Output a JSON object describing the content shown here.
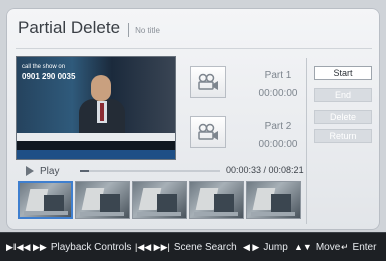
{
  "header": {
    "title": "Partial Delete",
    "subtitle": "No title"
  },
  "preview": {
    "phone_small": "call the show on",
    "phone_number": "0901 290 0035"
  },
  "parts": [
    {
      "label": "Part 1",
      "time": "00:00:00"
    },
    {
      "label": "Part 2",
      "time": "00:00:00"
    }
  ],
  "buttons": {
    "start": "Start",
    "end": "End",
    "delete": "Delete",
    "return": "Return"
  },
  "playback": {
    "play_label": "Play",
    "time_readout": "00:00:33 / 00:08:21",
    "progress_fraction": 0.066
  },
  "thumbnails": {
    "count": 5,
    "selected_index": 0
  },
  "hints": [
    {
      "symbol": "▶ǁ◀◀ ▶▶",
      "label": "Playback Controls"
    },
    {
      "symbol": "|◀◀ ▶▶|",
      "label": "Scene Search"
    },
    {
      "symbol": "◀ ▶",
      "label": "Jump"
    },
    {
      "symbol": "▲▼",
      "label": "Move"
    },
    {
      "symbol": "↵",
      "label": "Enter"
    }
  ],
  "colors": {
    "accent_selected": "#3f7fcf",
    "bar_bg": "#1d2024"
  }
}
